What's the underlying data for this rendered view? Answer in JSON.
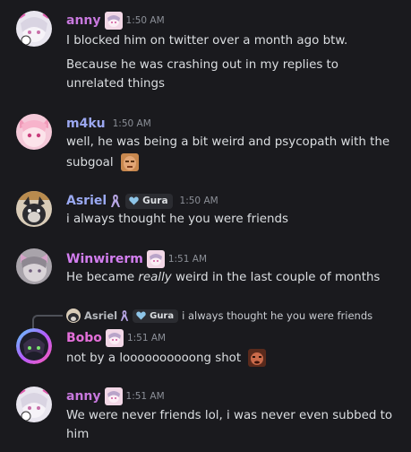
{
  "messages": [
    {
      "username": "anny",
      "username_color": "#c778dd",
      "timestamp": "1:50 AM",
      "lines": [
        "I blocked him on twitter over a month ago btw.",
        "Because he was crashing out in my replies to",
        "unrelated things"
      ]
    },
    {
      "username": "m4ku",
      "username_color": "#9ba7f0",
      "timestamp": "1:50 AM",
      "lines": [
        "well, he was being a bit weird and psycopath with the",
        "subgoal"
      ]
    },
    {
      "username": "Asriel",
      "username_color": "#9aa9f2",
      "tag": "Gura",
      "timestamp": "1:50 AM",
      "lines": [
        "i always thought he you were friends"
      ]
    },
    {
      "username": "Winwirerm",
      "username_color": "#d37ef0",
      "timestamp": "1:51 AM",
      "lines_pre": "He became ",
      "lines_em": "really",
      "lines_post": " weird in the last couple of months"
    },
    {
      "reply": {
        "username": "Asriel",
        "tag": "Gura",
        "text": "i always thought he you were friends"
      },
      "username": "Bobo",
      "username_color": "#e36fd9",
      "timestamp": "1:51 AM",
      "lines": [
        "not by a loooooooooong shot"
      ]
    },
    {
      "username": "anny",
      "username_color": "#c778dd",
      "timestamp": "1:51 AM",
      "lines": [
        "We were never friends lol, i was never even subbed to",
        "him"
      ]
    }
  ],
  "icons": {
    "ribbon": "awareness-ribbon-icon",
    "tag_heart": "heart-icon",
    "role_emote": "anime-girl-emote",
    "subgoal_emote": "face-emote",
    "shot_emote": "face-emote"
  }
}
